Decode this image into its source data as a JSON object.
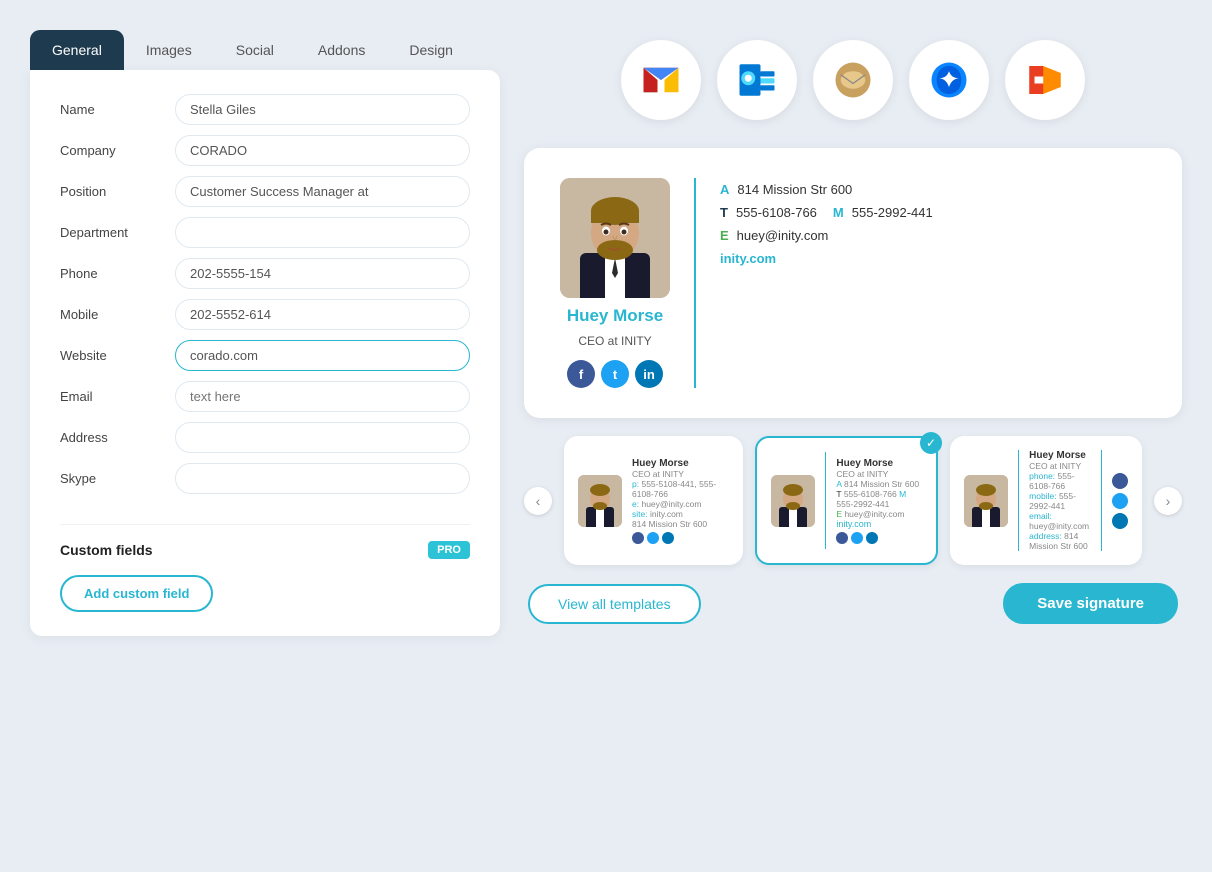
{
  "tabs": [
    {
      "label": "General",
      "active": true
    },
    {
      "label": "Images",
      "active": false
    },
    {
      "label": "Social",
      "active": false
    },
    {
      "label": "Addons",
      "active": false
    },
    {
      "label": "Design",
      "active": false
    }
  ],
  "form": {
    "name_label": "Name",
    "name_value": "Stella Giles",
    "company_label": "Company",
    "company_value": "CORADO",
    "position_label": "Position",
    "position_value": "Customer Success Manager at",
    "department_label": "Department",
    "department_value": "",
    "phone_label": "Phone",
    "phone_value": "202-5555-154",
    "mobile_label": "Mobile",
    "mobile_value": "202-5552-614",
    "website_label": "Website",
    "website_value": "corado.com",
    "email_label": "Email",
    "email_value": "text here",
    "address_label": "Address",
    "address_value": "",
    "skype_label": "Skype",
    "skype_value": ""
  },
  "custom_fields": {
    "title": "Custom fields",
    "pro_badge": "PRO",
    "add_btn": "Add custom field"
  },
  "email_clients": [
    {
      "name": "gmail",
      "icon": "M"
    },
    {
      "name": "outlook",
      "icon": "O"
    },
    {
      "name": "apple-mail",
      "icon": "✉"
    },
    {
      "name": "thunderbird",
      "icon": "⚡"
    },
    {
      "name": "office365",
      "icon": "☰"
    }
  ],
  "signature": {
    "name": "Huey Morse",
    "title": "CEO at INITY",
    "address_label": "A",
    "address_value": "814 Mission Str 600",
    "phone_label": "T",
    "phone_value": "555-6108-766",
    "mobile_label": "M",
    "mobile_value": "555-2992-441",
    "email_label": "E",
    "email_value": "huey@inity.com",
    "website": "inity.com"
  },
  "templates": [
    {
      "name": "Huey Morse",
      "title": "CEO at INITY",
      "phone": "555-5108-441, 555-6108-766",
      "email": "huey@inity.com",
      "website": "inity.com",
      "address": "814 Mission Str 600",
      "selected": false
    },
    {
      "name": "Huey Morse",
      "title": "CEO at INITY",
      "address": "814 Mission Str 600",
      "phone": "555-6108-766",
      "mobile": "555-2992-441",
      "email": "huey@inity.com",
      "website": "inity.com",
      "selected": true
    },
    {
      "name": "Huey Morse",
      "title": "CEO at INITY",
      "phone": "555-6108-766",
      "mobile": "555-2992-441",
      "email": "huey@inity.com",
      "address": "814 Mission Str 600",
      "selected": false
    }
  ],
  "buttons": {
    "view_templates": "View all templates",
    "save": "Save signature"
  },
  "colors": {
    "accent": "#29b6d0",
    "dark": "#1e3a4f",
    "facebook": "#3b5998",
    "twitter": "#1da1f2",
    "linkedin": "#0077b5"
  }
}
